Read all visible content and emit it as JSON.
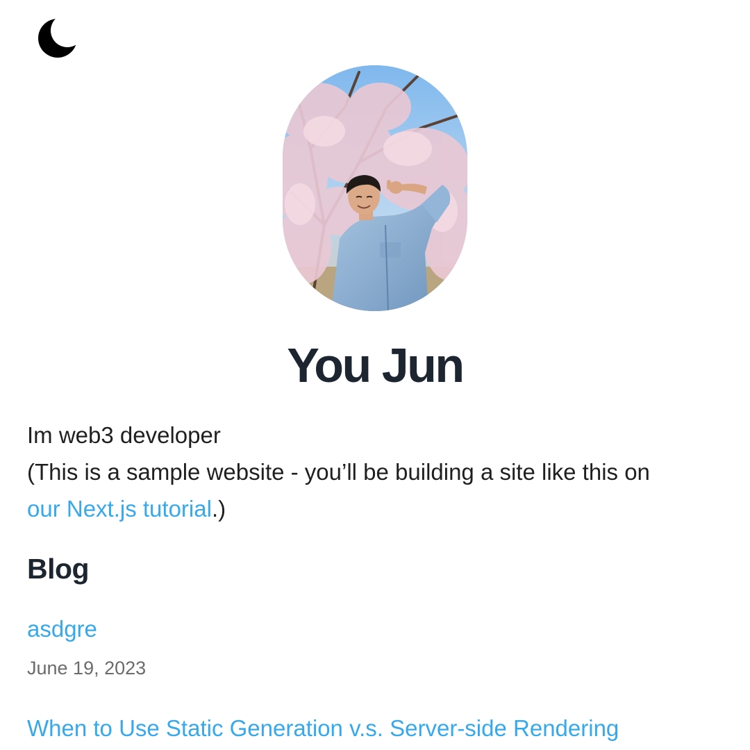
{
  "theme_toggle": {
    "icon": "moon-icon",
    "color": "#000000"
  },
  "profile": {
    "name": "You Jun",
    "avatar": {
      "subject": "person in denim shirt under cherry blossom tree"
    }
  },
  "intro": {
    "line1": "Im web3 developer",
    "line2": "(This is a sample website - you’ll be building a site like this on",
    "link_text": "our Next.js tutorial",
    "trailing": ".)"
  },
  "blog": {
    "heading": "Blog",
    "posts": [
      {
        "title": "asdgre",
        "date": "June 19, 2023"
      },
      {
        "title": "When to Use Static Generation v.s. Server-side Rendering"
      }
    ]
  },
  "colors": {
    "link": "#36a9ec",
    "heading": "#1d2531",
    "date": "#6b6b6b"
  }
}
